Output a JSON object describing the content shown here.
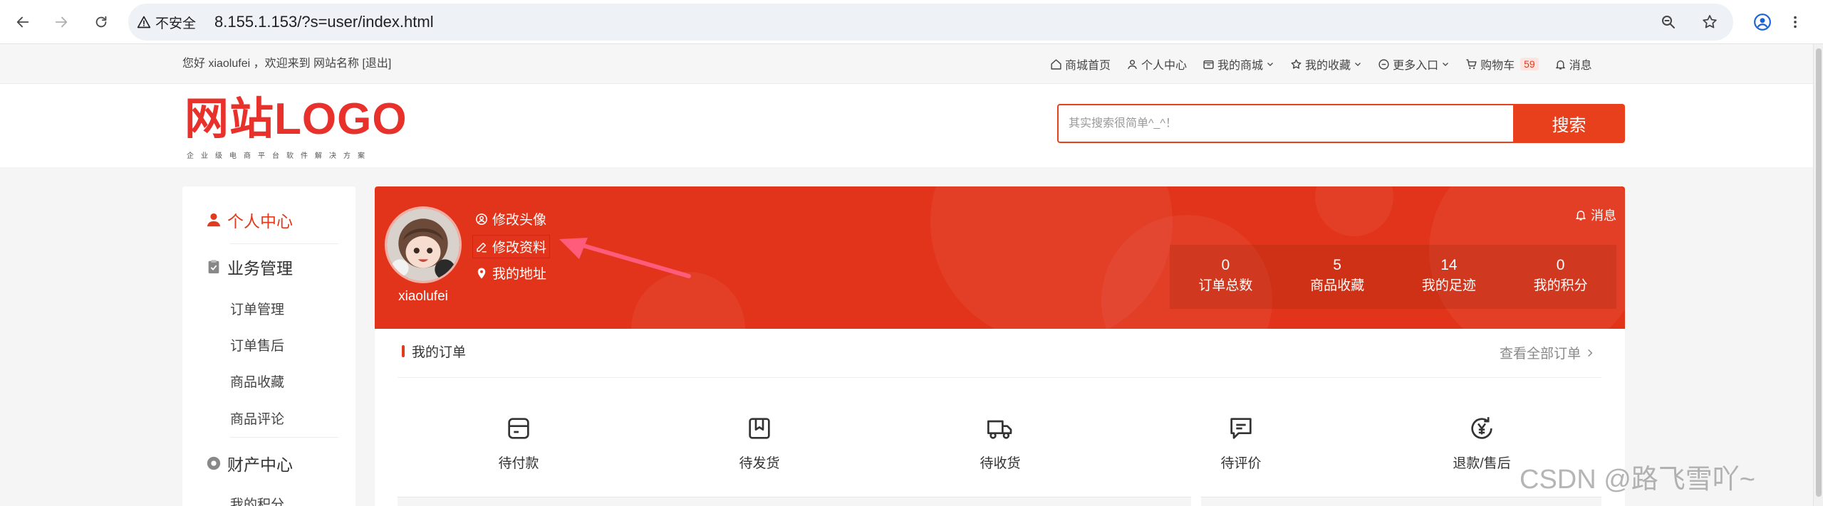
{
  "browser": {
    "security_label": "不安全",
    "url": "8.155.1.153/?s=user/index.html"
  },
  "topbar": {
    "welcome": "您好 xiaolufei ，欢迎来到 网站名称 [退出]",
    "nav": [
      {
        "label": "商城首页",
        "icon": "home-icon"
      },
      {
        "label": "个人中心",
        "icon": "user-icon"
      },
      {
        "label": "我的商城",
        "icon": "store-icon"
      },
      {
        "label": "我的收藏",
        "icon": "star-icon"
      },
      {
        "label": "更多入口",
        "icon": "more-icon"
      },
      {
        "label": "购物车",
        "icon": "cart-icon",
        "count": "59"
      },
      {
        "label": "消息",
        "icon": "bell-icon"
      }
    ]
  },
  "header": {
    "logo": "网站LOGO",
    "slogan": "企业级电商平台软件解决方案",
    "search_placeholder": "其实搜索很简单^_^！",
    "search_button": "搜索",
    "brand_color": "#e8312a"
  },
  "sidebar": {
    "sections": [
      {
        "title": "个人中心",
        "icon": "person-icon",
        "active": true,
        "items": []
      },
      {
        "title": "业务管理",
        "icon": "clipboard-icon",
        "active": false,
        "items": [
          "订单管理",
          "订单售后",
          "商品收藏",
          "商品评论"
        ]
      },
      {
        "title": "财产中心",
        "icon": "coin-icon",
        "active": false,
        "items": [
          "我的积分"
        ]
      }
    ]
  },
  "profile": {
    "username": "xiaolufei",
    "links": [
      {
        "label": "修改头像",
        "icon": "avatar-edit-icon"
      },
      {
        "label": "修改资料",
        "icon": "edit-icon"
      },
      {
        "label": "我的地址",
        "icon": "location-icon"
      }
    ],
    "message": "消息",
    "stats": [
      {
        "value": "0",
        "label": "订单总数"
      },
      {
        "value": "5",
        "label": "商品收藏"
      },
      {
        "value": "14",
        "label": "我的足迹"
      },
      {
        "value": "0",
        "label": "我的积分"
      }
    ],
    "accent_color": "#e2341b"
  },
  "orders": {
    "title": "我的订单",
    "view_all": "查看全部订单",
    "items": [
      {
        "label": "待付款",
        "icon": "wallet-icon"
      },
      {
        "label": "待发货",
        "icon": "package-icon"
      },
      {
        "label": "待收货",
        "icon": "truck-icon"
      },
      {
        "label": "待评价",
        "icon": "comment-icon"
      },
      {
        "label": "退款/售后",
        "icon": "refund-icon"
      }
    ]
  },
  "watermark": "CSDN @路飞雪吖~"
}
